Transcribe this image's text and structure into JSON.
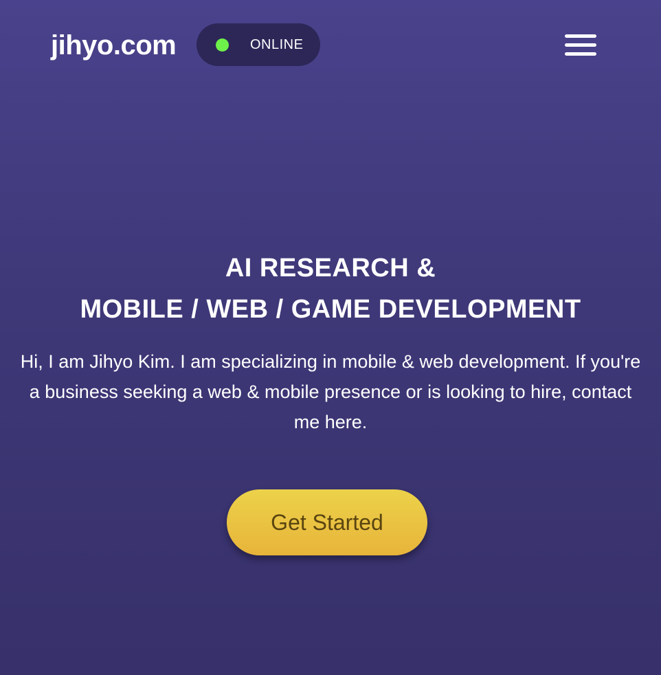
{
  "header": {
    "logo_text": "jihyo.com",
    "status": {
      "label": "ONLINE",
      "dot_color": "#6ef04a"
    },
    "menu_icon": "hamburger-menu-icon"
  },
  "hero": {
    "title_line1": "AI RESEARCH &",
    "title_line2": "MOBILE / WEB / GAME DEVELOPMENT",
    "description": "Hi, I am Jihyo Kim. I am specializing in mobile & web development. If you're a business seeking a web & mobile presence or is looking to hire, contact me here.",
    "cta_label": "Get Started"
  },
  "colors": {
    "background_top": "#4a428c",
    "background_bottom": "#37306a",
    "status_pill": "#2c2757",
    "cta_gradient_top": "#ecd24a",
    "cta_gradient_bottom": "#e8b43a",
    "cta_text": "#5a4510"
  }
}
